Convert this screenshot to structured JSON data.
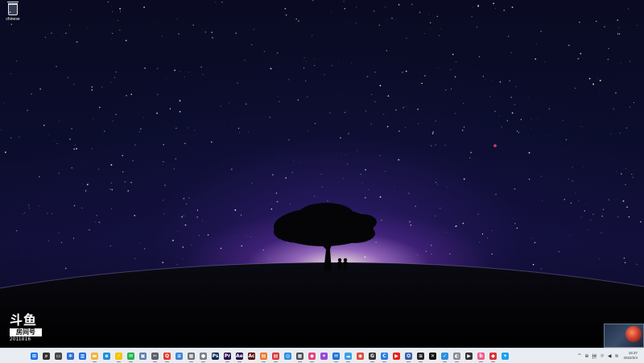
{
  "desktop": {
    "icons": [
      {
        "label": "chinese",
        "icon": "recycle-bin-icon"
      }
    ]
  },
  "watermark": {
    "logo_text": "斗鱼",
    "box_text": "房间号",
    "room_id": "2011816"
  },
  "taskbar": {
    "apps": [
      {
        "name": "start",
        "icon": "windows-start-icon",
        "glyph": "⊞",
        "color": "#1a73e8"
      },
      {
        "name": "search",
        "icon": "search-icon",
        "glyph": "⌕",
        "color": "#333333"
      },
      {
        "name": "taskview",
        "icon": "task-view-icon",
        "glyph": "▭",
        "color": "#444444"
      },
      {
        "name": "widgets",
        "icon": "widgets-icon",
        "glyph": "✻",
        "color": "#2b6cd9"
      },
      {
        "name": "snap",
        "icon": "snap-layout-icon",
        "glyph": "▥",
        "color": "#1f6fe0"
      },
      {
        "name": "explorer",
        "icon": "file-explorer-icon",
        "glyph": "▬",
        "color": "#f2b53b"
      },
      {
        "name": "edge",
        "icon": "edge-browser-icon",
        "glyph": "e",
        "color": "#1d8fd8"
      },
      {
        "name": "norton",
        "icon": "shield-icon",
        "glyph": "✓",
        "color": "#f5c400"
      },
      {
        "name": "wechat",
        "icon": "wechat-icon",
        "glyph": "✉",
        "color": "#22b24c"
      },
      {
        "name": "photos",
        "icon": "photos-icon",
        "glyph": "▣",
        "color": "#5c7fa8"
      },
      {
        "name": "screenshot",
        "icon": "snipping-tool-icon",
        "glyph": "✂",
        "color": "#5a5f69"
      },
      {
        "name": "qq",
        "icon": "qq-icon",
        "glyph": "Q",
        "color": "#e33b2e"
      },
      {
        "name": "notes",
        "icon": "notes-icon",
        "glyph": "≡",
        "color": "#3a86d6"
      },
      {
        "name": "calculator",
        "icon": "calculator-icon",
        "glyph": "▦",
        "color": "#6d6f74"
      },
      {
        "name": "mic",
        "icon": "microphone-icon",
        "glyph": "●",
        "color": "#7c7f86"
      },
      {
        "name": "photoshop",
        "icon": "photoshop-icon",
        "glyph": "Ps",
        "color": "#0c2a52"
      },
      {
        "name": "premiere",
        "icon": "premiere-icon",
        "glyph": "Pr",
        "color": "#2a0f4a"
      },
      {
        "name": "aftereffects",
        "icon": "after-effects-icon",
        "glyph": "Ae",
        "color": "#22124a"
      },
      {
        "name": "acrobat",
        "icon": "acrobat-icon",
        "glyph": "Ac",
        "color": "#5a0d0d"
      },
      {
        "name": "app-orange",
        "icon": "app-orange-icon",
        "glyph": "▤",
        "color": "#e8782b"
      },
      {
        "name": "app-red",
        "icon": "app-red-icon",
        "glyph": "▤",
        "color": "#d63a3a"
      },
      {
        "name": "app-blue",
        "icon": "app-blue-icon",
        "glyph": "◎",
        "color": "#2d8fe0"
      },
      {
        "name": "app-grid",
        "icon": "app-grid-icon",
        "glyph": "▦",
        "color": "#4a4d55"
      },
      {
        "name": "app-pink",
        "icon": "app-pink-icon",
        "glyph": "◆",
        "color": "#e4447a"
      },
      {
        "name": "app-multi",
        "icon": "app-multi-icon",
        "glyph": "✦",
        "color": "#9a4ad8"
      },
      {
        "name": "mail",
        "icon": "mail-icon",
        "glyph": "✉",
        "color": "#1a73d9"
      },
      {
        "name": "app-cloud",
        "icon": "cloud-icon",
        "glyph": "☁",
        "color": "#3aa0e8"
      },
      {
        "name": "chrome",
        "icon": "chrome-icon",
        "glyph": "◉",
        "color": "#dd4b39"
      },
      {
        "name": "app-g",
        "icon": "app-g-icon",
        "glyph": "G",
        "color": "#333333"
      },
      {
        "name": "app-c",
        "icon": "app-c-icon",
        "glyph": "C",
        "color": "#2a7de1"
      },
      {
        "name": "youtube",
        "icon": "youtube-icon",
        "glyph": "▶",
        "color": "#e62117"
      },
      {
        "name": "app-hat",
        "icon": "app-hat-icon",
        "glyph": "✪",
        "color": "#3a5fa8"
      },
      {
        "name": "app-lines",
        "icon": "app-lines-icon",
        "glyph": "≋",
        "color": "#222222"
      },
      {
        "name": "capcut",
        "icon": "capcut-icon",
        "glyph": "✕",
        "color": "#111111"
      },
      {
        "name": "app-check",
        "icon": "app-check-icon",
        "glyph": "✓",
        "color": "#2d8fe0"
      },
      {
        "name": "app-grey",
        "icon": "app-grey-icon",
        "glyph": "◐",
        "color": "#8a8d94"
      },
      {
        "name": "player",
        "icon": "player-icon",
        "glyph": "▶",
        "color": "#333333"
      },
      {
        "name": "app-bilibili",
        "icon": "bilibili-icon",
        "glyph": "b",
        "color": "#ef5c8c"
      },
      {
        "name": "app-red2",
        "icon": "app-red2-icon",
        "glyph": "◆",
        "color": "#d8333a"
      },
      {
        "name": "twitter",
        "icon": "twitter-icon",
        "glyph": "✦",
        "color": "#1da1f2"
      }
    ],
    "tray": [
      {
        "name": "chevron",
        "icon": "chevron-up-icon",
        "glyph": "^"
      },
      {
        "name": "network-app",
        "icon": "app-tray-icon",
        "glyph": "⊕"
      },
      {
        "name": "ime",
        "icon": "input-method-icon",
        "glyph": "拼"
      },
      {
        "name": "weather",
        "icon": "weather-icon",
        "glyph": "☼"
      },
      {
        "name": "volume",
        "icon": "volume-icon",
        "glyph": "◀"
      },
      {
        "name": "wifi",
        "icon": "wifi-icon",
        "glyph": "≋"
      }
    ],
    "clock": {
      "time": "15:37",
      "date": "2022/2/4"
    }
  }
}
